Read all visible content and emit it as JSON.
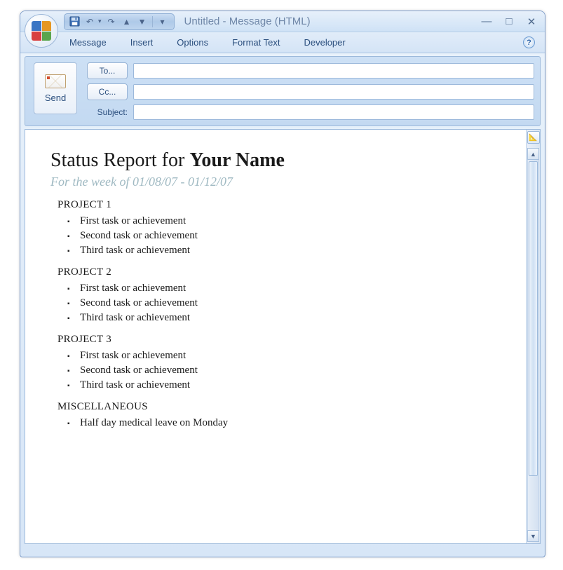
{
  "window": {
    "title": "Untitled - Message (HTML)"
  },
  "ribbon": {
    "tabs": [
      "Message",
      "Insert",
      "Options",
      "Format Text",
      "Developer"
    ]
  },
  "compose": {
    "send_label": "Send",
    "to_label": "To...",
    "cc_label": "Cc...",
    "subject_label": "Subject:",
    "to_value": "",
    "cc_value": "",
    "subject_value": ""
  },
  "body": {
    "title_prefix": "Status Report for ",
    "title_name": "Your Name",
    "subtitle": "For the week of 01/08/07 - 01/12/07",
    "sections": [
      {
        "heading": "PROJECT 1",
        "items": [
          "First task or achievement",
          "Second task or achievement",
          "Third task or achievement"
        ]
      },
      {
        "heading": "PROJECT 2",
        "items": [
          "First task or achievement",
          "Second task or achievement",
          "Third task or achievement"
        ]
      },
      {
        "heading": "PROJECT 3",
        "items": [
          "First task or achievement",
          "Second task or achievement",
          "Third task or achievement"
        ]
      },
      {
        "heading": "MISCELLANEOUS",
        "items": [
          "Half day medical leave on Monday"
        ]
      }
    ]
  }
}
